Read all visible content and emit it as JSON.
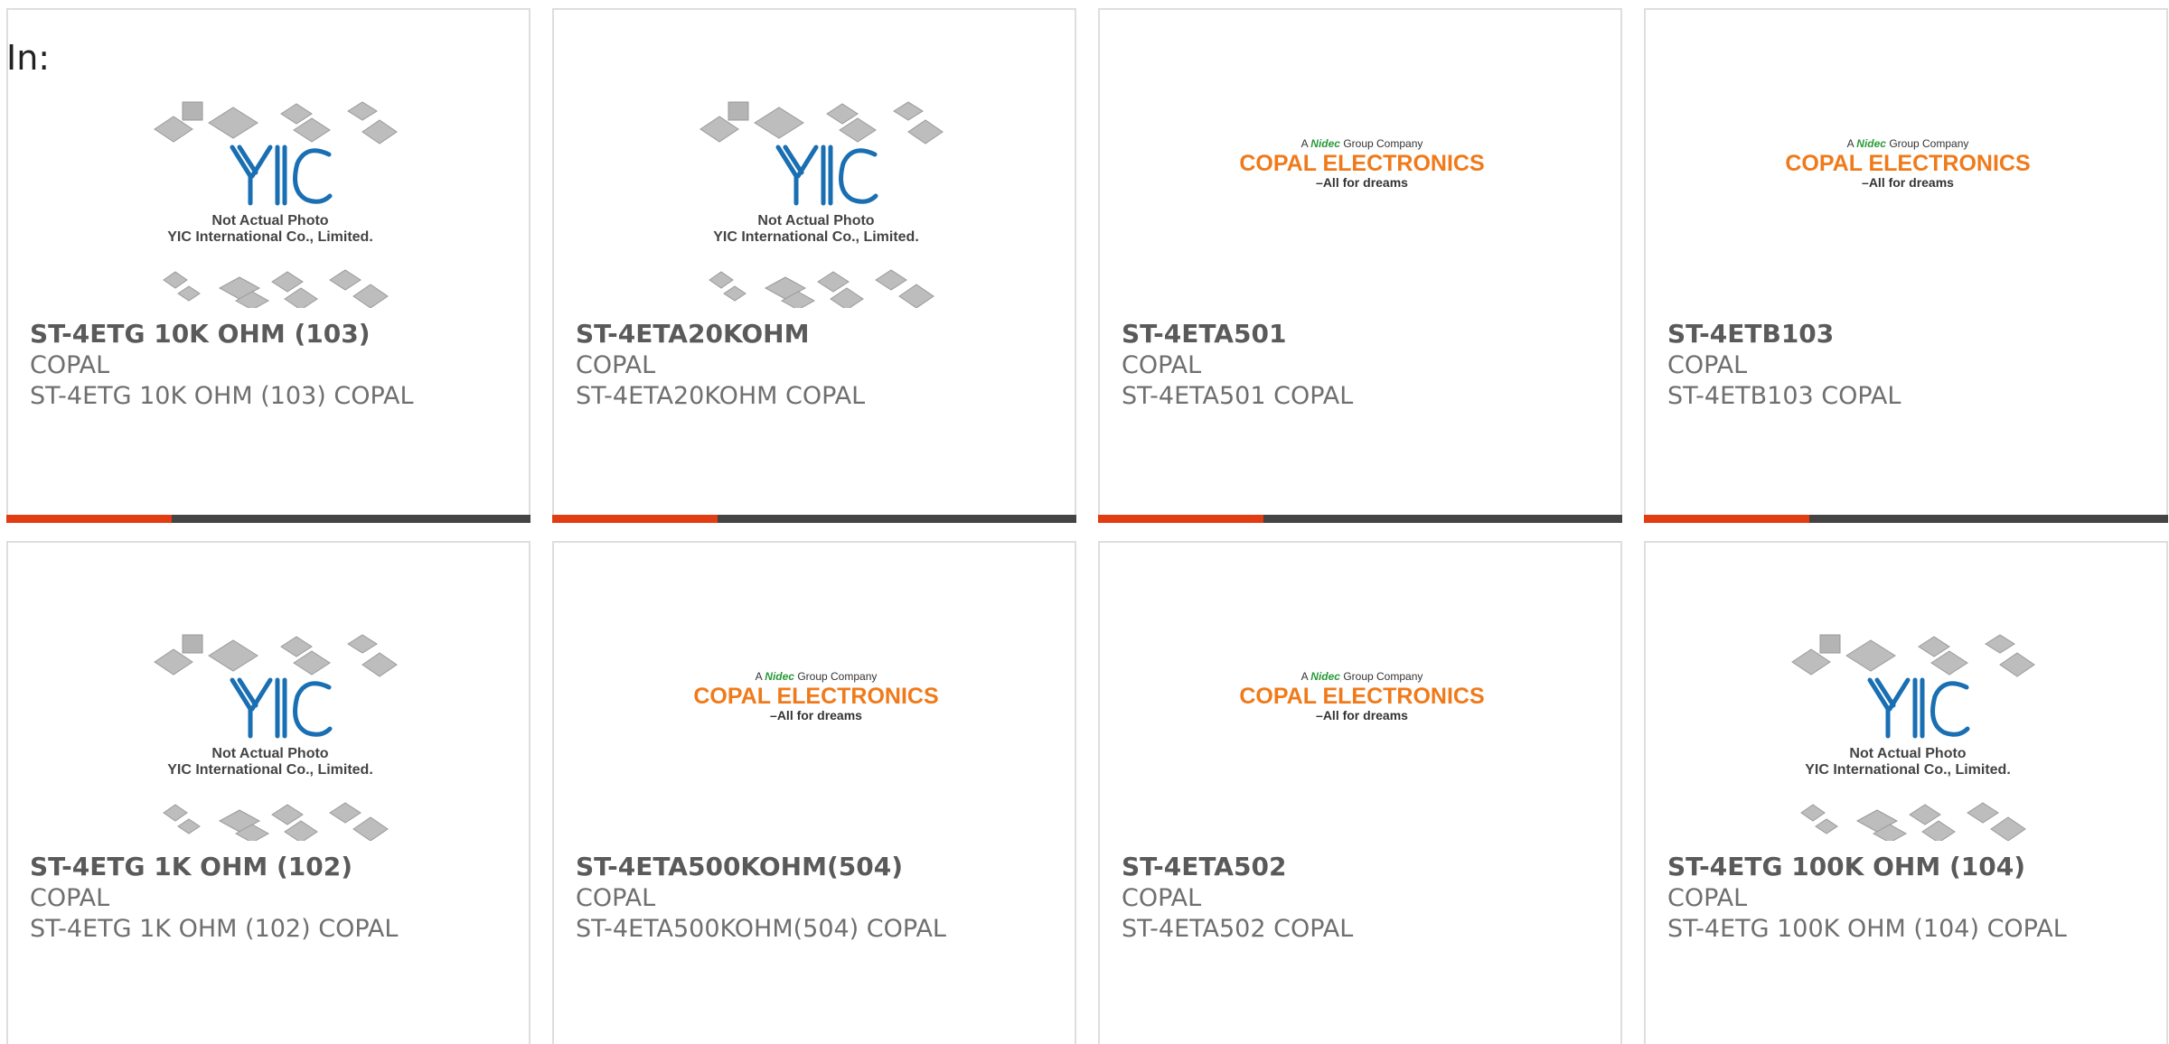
{
  "header": {
    "in_label": "In:"
  },
  "logos": {
    "yic": {
      "line1": "Not Actual Photo",
      "line2": "YIC International Co., Limited.",
      "mark": "YIC"
    },
    "copal": {
      "tagline_top": "A Nidec Group Company",
      "name": "COPAL ELECTRONICS",
      "slogan": "–All for dreams"
    }
  },
  "products": [
    {
      "title": "ST-4ETG 10K OHM (103)",
      "brand": "COPAL",
      "desc": "ST-4ETG 10K OHM (103) COPAL",
      "image": "yic"
    },
    {
      "title": "ST-4ETA20KOHM",
      "brand": "COPAL",
      "desc": "ST-4ETA20KOHM COPAL",
      "image": "yic"
    },
    {
      "title": "ST-4ETA501",
      "brand": "COPAL",
      "desc": "ST-4ETA501 COPAL",
      "image": "copal"
    },
    {
      "title": "ST-4ETB103",
      "brand": "COPAL",
      "desc": "ST-4ETB103 COPAL",
      "image": "copal"
    },
    {
      "title": "ST-4ETG 1K OHM (102)",
      "brand": "COPAL",
      "desc": "ST-4ETG 1K OHM (102) COPAL",
      "image": "yic"
    },
    {
      "title": "ST-4ETA500KOHM(504)",
      "brand": "COPAL",
      "desc": "ST-4ETA500KOHM(504) COPAL",
      "image": "copal"
    },
    {
      "title": "ST-4ETA502",
      "brand": "COPAL",
      "desc": "ST-4ETA502 COPAL",
      "image": "copal"
    },
    {
      "title": "ST-4ETG 100K OHM (104)",
      "brand": "COPAL",
      "desc": "ST-4ETG 100K OHM (104) COPAL",
      "image": "yic"
    }
  ],
  "colors": {
    "accent": "#e23c12",
    "bar": "#444444",
    "yic_blue": "#1a6fb3",
    "copal_orange": "#f07a1a",
    "nidec_green": "#2a9a3a"
  }
}
